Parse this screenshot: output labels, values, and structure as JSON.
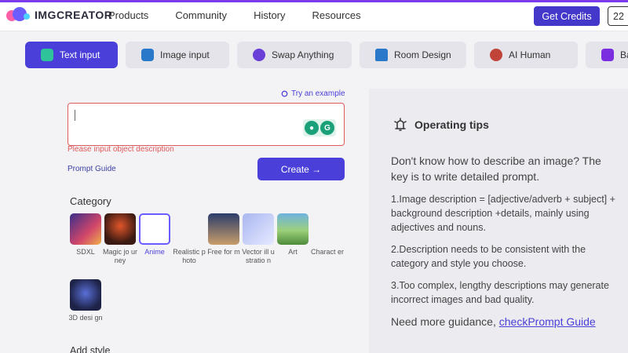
{
  "brand": {
    "name": "IMGCREATOR"
  },
  "nav": {
    "items": [
      "Products",
      "Community",
      "History",
      "Resources"
    ]
  },
  "header": {
    "get_credits": "Get Credits",
    "credits_count": "22"
  },
  "tabs": [
    {
      "label": "Text input",
      "icon": "text-icon",
      "active": true
    },
    {
      "label": "Image input",
      "icon": "image-icon",
      "active": false
    },
    {
      "label": "Swap Anything",
      "icon": "swap-icon",
      "active": false
    },
    {
      "label": "Room Design",
      "icon": "home-icon",
      "active": false
    },
    {
      "label": "AI Human",
      "icon": "person-icon",
      "active": false
    },
    {
      "label": "Back",
      "icon": "back-icon",
      "active": false
    }
  ],
  "prompt": {
    "try_example": "Try an example",
    "value": "",
    "error": "Please input object description",
    "guide": "Prompt Guide",
    "create": "Create →"
  },
  "category": {
    "label": "Category",
    "items": [
      {
        "name": "SDXL",
        "selected": false
      },
      {
        "name": "Magic jo urney",
        "selected": false
      },
      {
        "name": "Anime",
        "selected": true
      },
      {
        "name": "Realistic photo",
        "selected": false
      },
      {
        "name": "Free for m",
        "selected": false
      },
      {
        "name": "Vector ill ustratio n",
        "selected": false
      },
      {
        "name": "Art",
        "selected": false
      },
      {
        "name": "Charact er",
        "selected": false
      },
      {
        "name": "3D desi gn",
        "selected": false
      }
    ]
  },
  "add_style": "Add style",
  "tips": {
    "title": "Operating tips",
    "lead": "Don't know how to describe an image? The key is to write detailed prompt.",
    "items": [
      "1.Image description = [adjective/adverb + subject] + background description +details, mainly using adjectives and nouns.",
      "2.Description needs to be consistent with the category and style you choose.",
      "3.Too complex, lengthy descriptions may generate incorrect images and bad quality."
    ],
    "more_prefix": "Need more guidance, ",
    "more_link": "checkPrompt Guide"
  },
  "colors": {
    "primary": "#4a3fd8",
    "error": "#e05b5b",
    "accent_bar": "#7c3aed"
  }
}
